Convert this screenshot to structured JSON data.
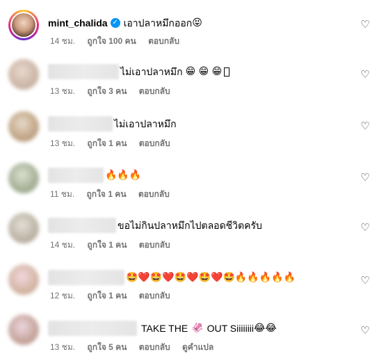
{
  "caption": {
    "username": "mint_chalida",
    "verified": true,
    "text": "เอาปลาหมึกออก",
    "emoji": "😝",
    "time": "14 ชม.",
    "likes": "ถูกใจ 100 คน",
    "reply": "ตอบกลับ"
  },
  "comments": [
    {
      "text": "ไม่เอาปลาหมึก",
      "emoji": "😁 😁 😁",
      "time": "13 ชม.",
      "likes": "ถูกใจ 3 คน",
      "reply": "ตอบกลับ"
    },
    {
      "text": "ไม่เอาปลาหมึก",
      "emoji": "",
      "time": "13 ชม.",
      "likes": "ถูกใจ 1 คน",
      "reply": "ตอบกลับ"
    },
    {
      "text": "",
      "emoji": "🔥🔥🔥",
      "time": "11 ชม.",
      "likes": "ถูกใจ 1 คน",
      "reply": "ตอบกลับ"
    },
    {
      "text": "ขอไม่กินปลาหมึกไปตลอดชีวิตครับ",
      "emoji": "",
      "time": "14 ชม.",
      "likes": "ถูกใจ 1 คน",
      "reply": "ตอบกลับ"
    },
    {
      "text": "",
      "emoji": "🤩❤️🤩❤️🤩❤️🤩❤️🤩🔥🔥🔥🔥🔥",
      "time": "12 ชม.",
      "likes": "ถูกใจ 1 คน",
      "reply": "ตอบกลับ"
    },
    {
      "text": "TAKE THE",
      "emoji_mid": "🦑",
      "text2": "OUT Siiiiiiii",
      "emoji": "😂😂",
      "time": "13 ชม.",
      "likes": "ถูกใจ 5 คน",
      "reply": "ตอบกลับ",
      "translate": "ดูคำแปล"
    }
  ],
  "icons": {
    "like": "heart-outline-icon",
    "verified": "verified-badge-icon"
  }
}
